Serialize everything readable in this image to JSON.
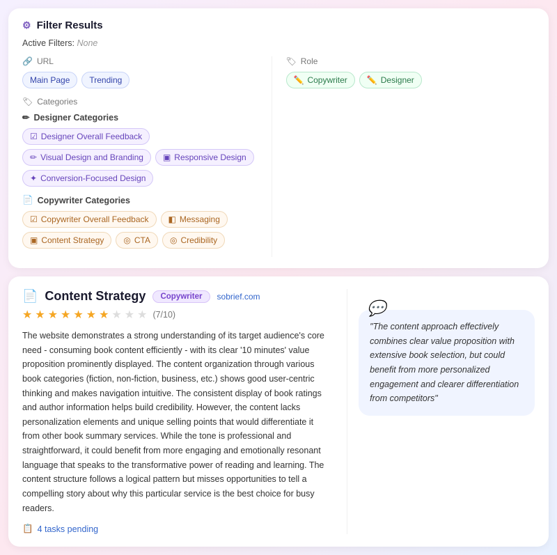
{
  "filter": {
    "title": "Filter Results",
    "active_filters_label": "Active Filters:",
    "active_filters_value": "None",
    "url_label": "URL",
    "url_tags": [
      {
        "id": "main-page",
        "label": "Main Page"
      },
      {
        "id": "trending",
        "label": "Trending"
      }
    ],
    "role_label": "Role",
    "role_tags": [
      {
        "id": "copywriter",
        "label": "Copywriter",
        "icon": "✏️"
      },
      {
        "id": "designer",
        "label": "Designer",
        "icon": "✏️"
      }
    ],
    "categories_label": "Categories",
    "designer_categories_label": "Designer Categories",
    "designer_categories": [
      {
        "id": "designer-overall",
        "label": "Designer Overall Feedback",
        "icon": "☑"
      },
      {
        "id": "visual-design",
        "label": "Visual Design and Branding",
        "icon": "✏"
      },
      {
        "id": "responsive",
        "label": "Responsive Design",
        "icon": "▣"
      },
      {
        "id": "conversion",
        "label": "Conversion-Focused Design",
        "icon": "✦"
      }
    ],
    "copywriter_categories_label": "Copywriter Categories",
    "copywriter_categories": [
      {
        "id": "copywriter-overall",
        "label": "Copywriter Overall Feedback",
        "icon": "☑"
      },
      {
        "id": "messaging",
        "label": "Messaging",
        "icon": "◧"
      },
      {
        "id": "content-strategy",
        "label": "Content Strategy",
        "icon": "▣"
      },
      {
        "id": "cta",
        "label": "CTA",
        "icon": "◎"
      },
      {
        "id": "credibility",
        "label": "Credibility",
        "icon": "◎"
      }
    ]
  },
  "card": {
    "title": "Content Strategy",
    "badge_copywriter": "Copywriter",
    "site": "sobrief.com",
    "rating": "7/10",
    "stars_filled": 7,
    "stars_empty": 3,
    "body": "The website demonstrates a strong understanding of its target audience's core need - consuming book content efficiently - with its clear '10 minutes' value proposition prominently displayed. The content organization through various book categories (fiction, non-fiction, business, etc.) shows good user-centric thinking and makes navigation intuitive. The consistent display of book ratings and author information helps build credibility. However, the content lacks personalization elements and unique selling points that would differentiate it from other book summary services. While the tone is professional and straightforward, it could benefit from more engaging and emotionally resonant language that speaks to the transformative power of reading and learning. The content structure follows a logical pattern but misses opportunities to tell a compelling story about why this particular service is the best choice for busy readers.",
    "tasks_label": "4 tasks pending",
    "quote": "\"The content approach effectively combines clear value proposition with extensive book selection, but could benefit from more personalized engagement and clearer differentiation from competitors\""
  }
}
